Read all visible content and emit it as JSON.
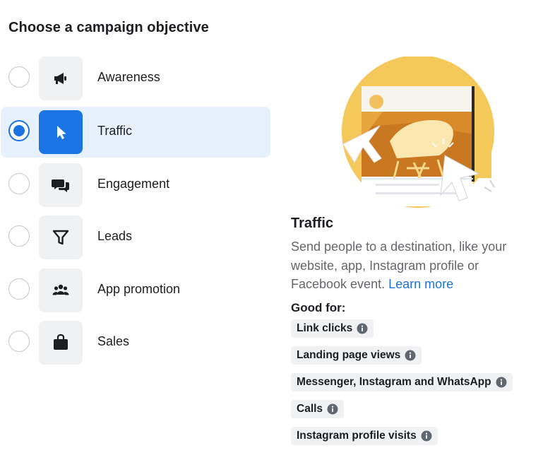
{
  "title": "Choose a campaign objective",
  "objectives": [
    {
      "label": "Awareness",
      "icon": "megaphone-icon",
      "selected": false
    },
    {
      "label": "Traffic",
      "icon": "cursor-icon",
      "selected": true
    },
    {
      "label": "Engagement",
      "icon": "speech-bubbles-icon",
      "selected": false
    },
    {
      "label": "Leads",
      "icon": "filter-icon",
      "selected": false
    },
    {
      "label": "App promotion",
      "icon": "people-group-icon",
      "selected": false
    },
    {
      "label": "Sales",
      "icon": "shopping-bag-icon",
      "selected": false
    }
  ],
  "detail": {
    "title": "Traffic",
    "description": "Send people to a destination, like your website, app, Instagram profile or Facebook event.",
    "learn_more": "Learn more",
    "good_for_label": "Good for:",
    "good_for": [
      "Link clicks",
      "Landing page views",
      "Messenger, Instagram and WhatsApp",
      "Calls",
      "Instagram profile visits"
    ]
  },
  "colors": {
    "accent": "#1b74e4",
    "selected_row": "#e7f0fd",
    "tile": "#eff1f3",
    "muted_text": "#65676b"
  }
}
